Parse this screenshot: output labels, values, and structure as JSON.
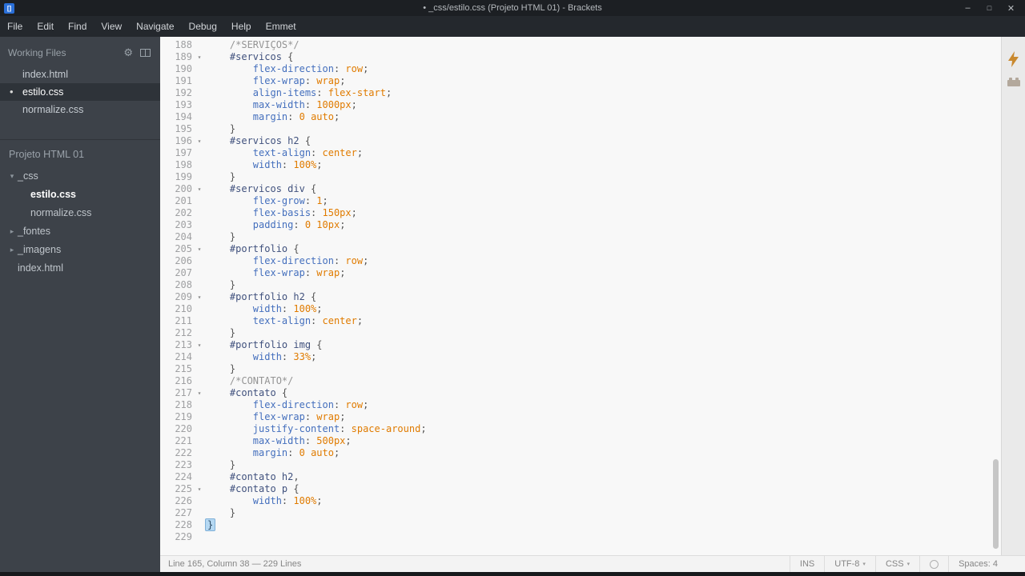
{
  "window": {
    "title": "• _css/estilo.css (Projeto HTML 01) - Brackets"
  },
  "icons": {
    "logo": "[]",
    "minimize": "–",
    "restore": "□",
    "close": "✕",
    "gear": "⚙",
    "unsaved_dot": "•",
    "expanded": "▾",
    "collapsed": "▸",
    "fold": "▾",
    "dropdown": "▾"
  },
  "theme": {
    "editor_bg": "#f8f8f8",
    "sidebar_bg": "#3d4249",
    "comment_gray": "#949494",
    "selector_navy": "#40517d",
    "property_blue": "#446fbd",
    "value_orange": "#e07b00",
    "live_preview_orange": "#c9892f"
  },
  "menubar": {
    "items": [
      "File",
      "Edit",
      "Find",
      "View",
      "Navigate",
      "Debug",
      "Help",
      "Emmet"
    ]
  },
  "sidebar": {
    "working_files": {
      "header": "Working Files",
      "items": [
        {
          "name": "index.html"
        },
        {
          "name": "estilo.css",
          "active": true,
          "unsaved": true
        },
        {
          "name": "normalize.css"
        }
      ]
    },
    "project": {
      "title": "Projeto HTML 01",
      "tree": [
        {
          "label": "_css",
          "type": "folder",
          "state": "expanded",
          "depth": 0
        },
        {
          "label": "estilo.css",
          "type": "file",
          "depth": 1,
          "selected": true
        },
        {
          "label": "normalize.css",
          "type": "file",
          "depth": 1
        },
        {
          "label": "_fontes",
          "type": "folder",
          "state": "collapsed",
          "depth": 0
        },
        {
          "label": "_imagens",
          "type": "folder",
          "state": "collapsed",
          "depth": 0
        },
        {
          "label": "index.html",
          "type": "file",
          "depth": 0
        }
      ]
    }
  },
  "editor": {
    "lines": [
      {
        "n": 188,
        "tokens": [
          [
            "d",
            "    "
          ],
          [
            "c",
            "/*SERVIÇOS*/"
          ]
        ]
      },
      {
        "n": 189,
        "fold": 1,
        "tokens": [
          [
            "d",
            "    "
          ],
          [
            "s",
            "#servicos"
          ],
          [
            "d",
            " {"
          ]
        ]
      },
      {
        "n": 190,
        "tokens": [
          [
            "d",
            "        "
          ],
          [
            "p",
            "flex-direction"
          ],
          [
            "d",
            ": "
          ],
          [
            "v",
            "row"
          ],
          [
            "d",
            ";"
          ]
        ]
      },
      {
        "n": 191,
        "tokens": [
          [
            "d",
            "        "
          ],
          [
            "p",
            "flex-wrap"
          ],
          [
            "d",
            ": "
          ],
          [
            "v",
            "wrap"
          ],
          [
            "d",
            ";"
          ]
        ]
      },
      {
        "n": 192,
        "tokens": [
          [
            "d",
            "        "
          ],
          [
            "p",
            "align-items"
          ],
          [
            "d",
            ": "
          ],
          [
            "v",
            "flex-start"
          ],
          [
            "d",
            ";"
          ]
        ]
      },
      {
        "n": 193,
        "tokens": [
          [
            "d",
            "        "
          ],
          [
            "p",
            "max-width"
          ],
          [
            "d",
            ": "
          ],
          [
            "v",
            "1000px"
          ],
          [
            "d",
            ";"
          ]
        ]
      },
      {
        "n": 194,
        "tokens": [
          [
            "d",
            "        "
          ],
          [
            "p",
            "margin"
          ],
          [
            "d",
            ": "
          ],
          [
            "v",
            "0"
          ],
          [
            "d",
            " "
          ],
          [
            "v",
            "auto"
          ],
          [
            "d",
            ";"
          ]
        ]
      },
      {
        "n": 195,
        "tokens": [
          [
            "d",
            "    }"
          ]
        ]
      },
      {
        "n": 196,
        "fold": 1,
        "tokens": [
          [
            "d",
            "    "
          ],
          [
            "s",
            "#servicos h2"
          ],
          [
            "d",
            " {"
          ]
        ]
      },
      {
        "n": 197,
        "tokens": [
          [
            "d",
            "        "
          ],
          [
            "p",
            "text-align"
          ],
          [
            "d",
            ": "
          ],
          [
            "v",
            "center"
          ],
          [
            "d",
            ";"
          ]
        ]
      },
      {
        "n": 198,
        "tokens": [
          [
            "d",
            "        "
          ],
          [
            "p",
            "width"
          ],
          [
            "d",
            ": "
          ],
          [
            "v",
            "100%"
          ],
          [
            "d",
            ";"
          ]
        ]
      },
      {
        "n": 199,
        "tokens": [
          [
            "d",
            "    }"
          ]
        ]
      },
      {
        "n": 200,
        "fold": 1,
        "tokens": [
          [
            "d",
            "    "
          ],
          [
            "s",
            "#servicos div"
          ],
          [
            "d",
            " {"
          ]
        ]
      },
      {
        "n": 201,
        "tokens": [
          [
            "d",
            "        "
          ],
          [
            "p",
            "flex-grow"
          ],
          [
            "d",
            ": "
          ],
          [
            "v",
            "1"
          ],
          [
            "d",
            ";"
          ]
        ]
      },
      {
        "n": 202,
        "tokens": [
          [
            "d",
            "        "
          ],
          [
            "p",
            "flex-basis"
          ],
          [
            "d",
            ": "
          ],
          [
            "v",
            "150px"
          ],
          [
            "d",
            ";"
          ]
        ]
      },
      {
        "n": 203,
        "tokens": [
          [
            "d",
            "        "
          ],
          [
            "p",
            "padding"
          ],
          [
            "d",
            ": "
          ],
          [
            "v",
            "0"
          ],
          [
            "d",
            " "
          ],
          [
            "v",
            "10px"
          ],
          [
            "d",
            ";"
          ]
        ]
      },
      {
        "n": 204,
        "tokens": [
          [
            "d",
            "    }"
          ]
        ]
      },
      {
        "n": 205,
        "fold": 1,
        "tokens": [
          [
            "d",
            "    "
          ],
          [
            "s",
            "#portfolio"
          ],
          [
            "d",
            " {"
          ]
        ]
      },
      {
        "n": 206,
        "tokens": [
          [
            "d",
            "        "
          ],
          [
            "p",
            "flex-direction"
          ],
          [
            "d",
            ": "
          ],
          [
            "v",
            "row"
          ],
          [
            "d",
            ";"
          ]
        ]
      },
      {
        "n": 207,
        "tokens": [
          [
            "d",
            "        "
          ],
          [
            "p",
            "flex-wrap"
          ],
          [
            "d",
            ": "
          ],
          [
            "v",
            "wrap"
          ],
          [
            "d",
            ";"
          ]
        ]
      },
      {
        "n": 208,
        "tokens": [
          [
            "d",
            "    }"
          ]
        ]
      },
      {
        "n": 209,
        "fold": 1,
        "tokens": [
          [
            "d",
            "    "
          ],
          [
            "s",
            "#portfolio h2"
          ],
          [
            "d",
            " {"
          ]
        ]
      },
      {
        "n": 210,
        "tokens": [
          [
            "d",
            "        "
          ],
          [
            "p",
            "width"
          ],
          [
            "d",
            ": "
          ],
          [
            "v",
            "100%"
          ],
          [
            "d",
            ";"
          ]
        ]
      },
      {
        "n": 211,
        "tokens": [
          [
            "d",
            "        "
          ],
          [
            "p",
            "text-align"
          ],
          [
            "d",
            ": "
          ],
          [
            "v",
            "center"
          ],
          [
            "d",
            ";"
          ]
        ]
      },
      {
        "n": 212,
        "tokens": [
          [
            "d",
            "    }"
          ]
        ]
      },
      {
        "n": 213,
        "fold": 1,
        "tokens": [
          [
            "d",
            "    "
          ],
          [
            "s",
            "#portfolio img"
          ],
          [
            "d",
            " {"
          ]
        ]
      },
      {
        "n": 214,
        "tokens": [
          [
            "d",
            "        "
          ],
          [
            "p",
            "width"
          ],
          [
            "d",
            ": "
          ],
          [
            "v",
            "33%"
          ],
          [
            "d",
            ";"
          ]
        ]
      },
      {
        "n": 215,
        "tokens": [
          [
            "d",
            "    }"
          ]
        ]
      },
      {
        "n": 216,
        "tokens": [
          [
            "d",
            "    "
          ],
          [
            "c",
            "/*CONTATO*/"
          ]
        ]
      },
      {
        "n": 217,
        "fold": 1,
        "tokens": [
          [
            "d",
            "    "
          ],
          [
            "s",
            "#contato"
          ],
          [
            "d",
            " {"
          ]
        ]
      },
      {
        "n": 218,
        "tokens": [
          [
            "d",
            "        "
          ],
          [
            "p",
            "flex-direction"
          ],
          [
            "d",
            ": "
          ],
          [
            "v",
            "row"
          ],
          [
            "d",
            ";"
          ]
        ]
      },
      {
        "n": 219,
        "tokens": [
          [
            "d",
            "        "
          ],
          [
            "p",
            "flex-wrap"
          ],
          [
            "d",
            ": "
          ],
          [
            "v",
            "wrap"
          ],
          [
            "d",
            ";"
          ]
        ]
      },
      {
        "n": 220,
        "tokens": [
          [
            "d",
            "        "
          ],
          [
            "p",
            "justify-content"
          ],
          [
            "d",
            ": "
          ],
          [
            "v",
            "space-around"
          ],
          [
            "d",
            ";"
          ]
        ]
      },
      {
        "n": 221,
        "tokens": [
          [
            "d",
            "        "
          ],
          [
            "p",
            "max-width"
          ],
          [
            "d",
            ": "
          ],
          [
            "v",
            "500px"
          ],
          [
            "d",
            ";"
          ]
        ]
      },
      {
        "n": 222,
        "tokens": [
          [
            "d",
            "        "
          ],
          [
            "p",
            "margin"
          ],
          [
            "d",
            ": "
          ],
          [
            "v",
            "0"
          ],
          [
            "d",
            " "
          ],
          [
            "v",
            "auto"
          ],
          [
            "d",
            ";"
          ]
        ]
      },
      {
        "n": 223,
        "tokens": [
          [
            "d",
            "    }"
          ]
        ]
      },
      {
        "n": 224,
        "tokens": [
          [
            "d",
            "    "
          ],
          [
            "s",
            "#contato h2"
          ],
          [
            "d",
            ","
          ]
        ]
      },
      {
        "n": 225,
        "fold": 1,
        "tokens": [
          [
            "d",
            "    "
          ],
          [
            "s",
            "#contato p"
          ],
          [
            "d",
            " {"
          ]
        ]
      },
      {
        "n": 226,
        "tokens": [
          [
            "d",
            "        "
          ],
          [
            "p",
            "width"
          ],
          [
            "d",
            ": "
          ],
          [
            "v",
            "100%"
          ],
          [
            "d",
            ";"
          ]
        ]
      },
      {
        "n": 227,
        "tokens": [
          [
            "d",
            "    }"
          ]
        ]
      },
      {
        "n": 228,
        "tokens": [
          [
            "b",
            "}"
          ]
        ]
      },
      {
        "n": 229,
        "tokens": []
      }
    ]
  },
  "statusbar": {
    "cursor": "Line 165, Column 38 — 229 Lines",
    "overwrite": "INS",
    "encoding": "UTF-8",
    "language": "CSS",
    "spaces": "Spaces: 4"
  }
}
